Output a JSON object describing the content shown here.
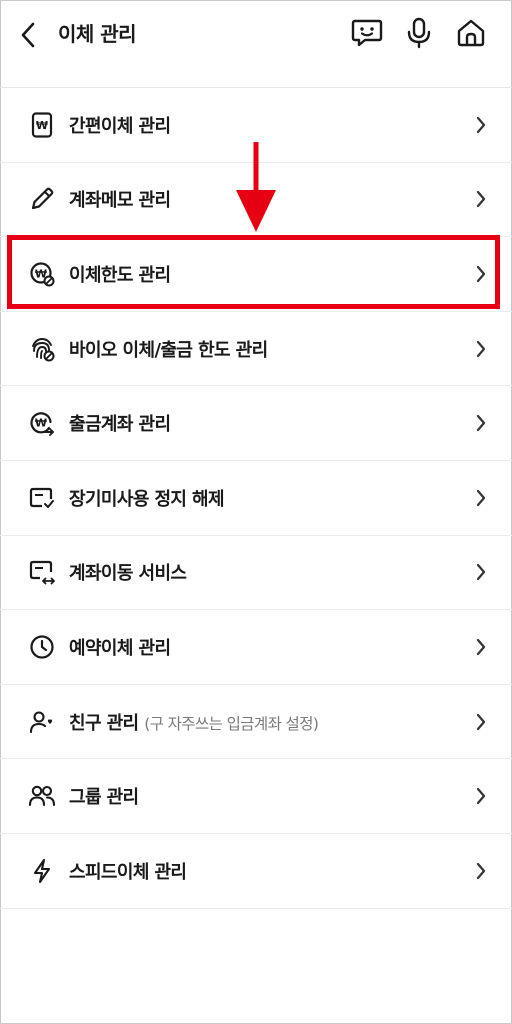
{
  "header": {
    "title": "이체 관리",
    "icons": [
      "back-icon",
      "chatbot-icon",
      "microphone-icon",
      "home-icon"
    ]
  },
  "menu": {
    "items": [
      {
        "label": "간편이체 관리",
        "icon": "phone-won-icon"
      },
      {
        "label": "계좌메모 관리",
        "icon": "pencil-icon"
      },
      {
        "label": "이체한도 관리",
        "icon": "won-limit-icon"
      },
      {
        "label": "바이오 이체/출금 한도 관리",
        "icon": "fingerprint-icon"
      },
      {
        "label": "출금계좌 관리",
        "icon": "won-arrow-icon"
      },
      {
        "label": "장기미사용 정지 해제",
        "icon": "card-check-icon"
      },
      {
        "label": "계좌이동 서비스",
        "icon": "card-transfer-icon"
      },
      {
        "label": "예약이체 관리",
        "icon": "clock-icon"
      },
      {
        "label": "친구 관리",
        "sub": "(구 자주쓰는 입금계좌 설정)",
        "icon": "person-heart-icon"
      },
      {
        "label": "그룹 관리",
        "icon": "people-icon"
      },
      {
        "label": "스피드이체 관리",
        "icon": "lightning-icon"
      }
    ]
  },
  "annotation": {
    "highlight_color": "#e60012",
    "highlighted_item": "이체한도 관리"
  }
}
